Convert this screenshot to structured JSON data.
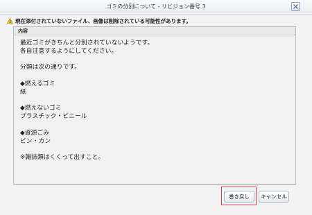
{
  "dialog": {
    "title": "ゴミの分別について - リビジョン番号 3",
    "close_icon": "close-icon"
  },
  "warning": {
    "icon": "warning-icon",
    "text": "現在添付されていないファイル、画像は削除されている可能性があります。"
  },
  "content": {
    "header": "内容",
    "lines": [
      "最近ゴミがきちんと分別されていないようです。",
      "各自注意するようにしてください。",
      "",
      "分類は次の通りです。",
      "",
      "◆燃えるゴミ",
      "紙",
      "",
      "◆燃えないゴミ",
      "プラスチック・ビニール",
      "",
      "◆資源ごみ",
      "ビン・カン",
      "",
      "※雑誌類はくくって出すこと。"
    ]
  },
  "buttons": {
    "revert_label": "巻き戻し",
    "cancel_label": "キャンセル"
  },
  "colors": {
    "highlight": "#e23a3a"
  }
}
